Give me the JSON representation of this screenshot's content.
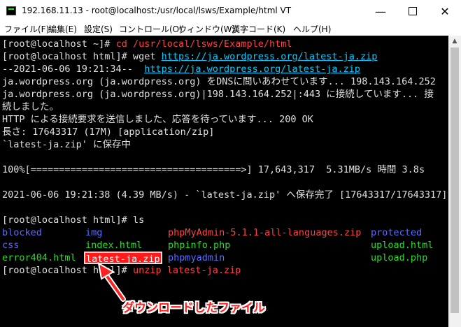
{
  "window": {
    "title": "192.168.11.13 - root@localhost:/usr/local/lsws/Example/html VT",
    "minimize_glyph": "—",
    "close_glyph": "✕"
  },
  "menu": [
    "ファイル(F)",
    "編集(E)",
    "設定(S)",
    "コントロール(O)",
    "ウィンドウ(W)",
    "漢字コード(K)",
    "ヘルプ(H)"
  ],
  "terminal": {
    "l1_prompt": "[root@localhost ~]# ",
    "l1_cmd": "cd /usr/local/lsws/Example/html",
    "l2_prompt": "[root@localhost html]# wget ",
    "l2_url": "https://ja.wordpress.org/latest-ja.zip",
    "l3_time": "--2021-06-06 19:21:34--  ",
    "l3_url": "https://ja.wordpress.org/latest-ja.zip",
    "l4": "ja.wordpress.org (ja.wordpress.org) をDNSに問いあわせています... 198.143.164.252",
    "l5": "ja.wordpress.org (ja.wordpress.org)|198.143.164.252|:443 に接続しています... 接",
    "l6": "続しました。",
    "l7": "HTTP による接続要求を送信しました、応答を待っています... 200 OK",
    "l8": "長さ: 17643317 (17M) [application/zip]",
    "l9": "`latest-ja.zip' に保存中",
    "l10": "100%[=====================================>] 17,643,317  5.31MB/s 時間 3.8s",
    "l11": "2021-06-06 19:21:38 (4.39 MB/s) - `latest-ja.zip' へ保存完了 [17643317/17643317]",
    "l12": "[root@localhost html]# ls",
    "ls": {
      "blocked": "blocked",
      "img": "img",
      "phpmyadmin_zip": "phpMyAdmin-5.1.1-all-languages.zip",
      "protected": "protected",
      "css": "css",
      "index": "index.html",
      "phpinfo": "phpinfo.php",
      "upload_html": "upload.html",
      "error404": "error404.html",
      "latest_zip": "latest-ja.zip",
      "phpmyadmin": "phpmyadmin",
      "upload_php": "upload.php"
    },
    "l16_prompt": "[root@localhost html]# ",
    "l16_cmd": "unzip latest-ja.zip"
  },
  "annotation": "ダウンロードしたファイル",
  "colors": {
    "prompt_text": "#e0e0e0",
    "command": "#ff4040",
    "url": "#00ccff",
    "directory": "#5a6bff",
    "executable": "#2bd82b",
    "archive": "#ff1a1a",
    "annotation": "#ff2020"
  }
}
